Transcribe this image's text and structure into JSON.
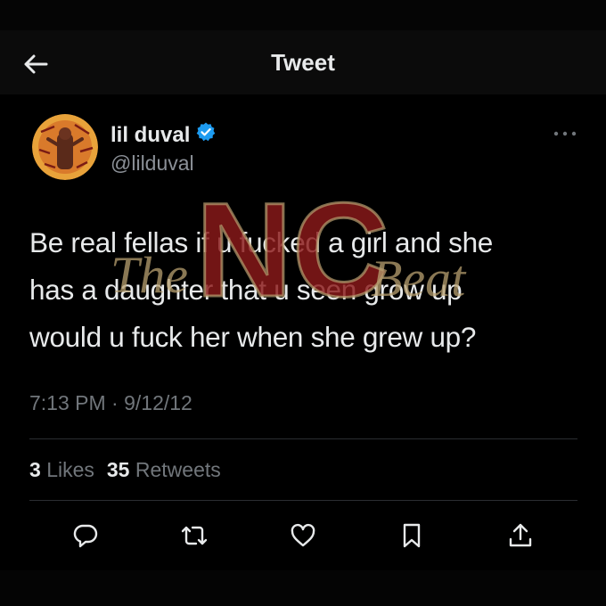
{
  "header": {
    "title": "Tweet"
  },
  "author": {
    "display_name": "lil duval",
    "handle": "@lilduval",
    "verified": true
  },
  "tweet": {
    "text": "Be real fellas if u fucked a girl and she\nhas a daughter that u seen grow up\nwould u fuck her when she grew up?",
    "timestamp": "7:13 PM · 9/12/12"
  },
  "stats": {
    "likes_count": "3",
    "likes_label": "Likes",
    "retweets_count": "35",
    "retweets_label": "Retweets"
  },
  "actions": [
    "reply-icon",
    "retweet-icon",
    "like-icon",
    "bookmark-icon",
    "share-icon"
  ],
  "colors": {
    "background": "#000000",
    "text": "#e7e9ea",
    "muted": "#71767b",
    "verified": "#1d9bf0",
    "watermark": "#8b1a1a"
  }
}
